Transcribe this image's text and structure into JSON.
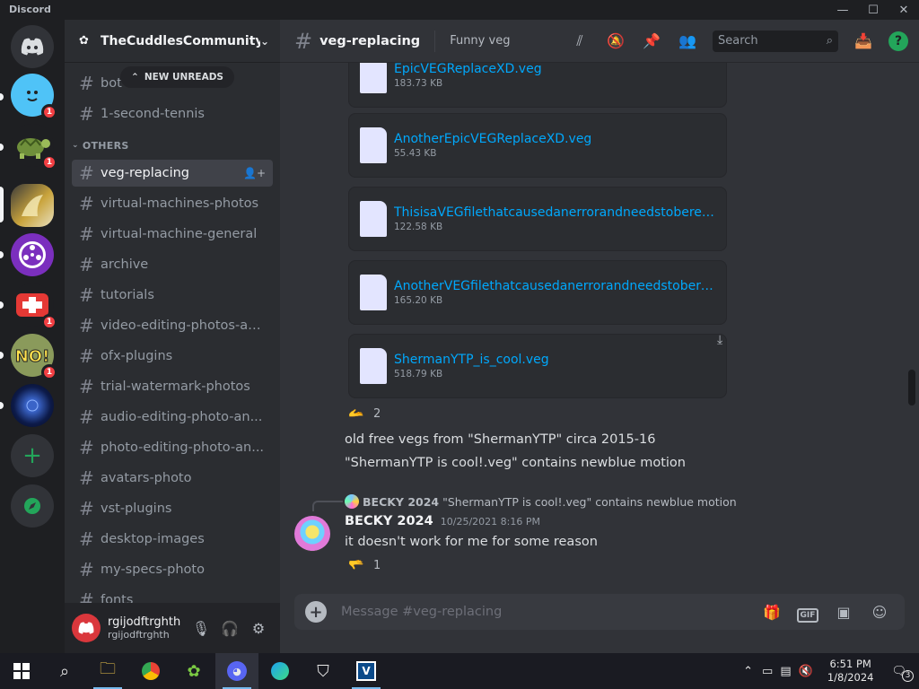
{
  "window": {
    "app_name": "Discord",
    "minimize": "—",
    "maximize": "☐",
    "close": "✕"
  },
  "servers": [
    {
      "name": "server-blue-face",
      "badge": "1",
      "color": "#4fc3f7"
    },
    {
      "name": "server-turtle",
      "badge": "1",
      "color": "#6f8f3b"
    },
    {
      "name": "server-yellow",
      "badge": "",
      "color": "#c9a43c"
    },
    {
      "name": "server-purple-reel",
      "badge": "",
      "color": "#7b2fbe"
    },
    {
      "name": "server-red-cross",
      "badge": "1",
      "color": "#e53935"
    },
    {
      "name": "server-no",
      "badge": "1",
      "color": "#8a9a5b"
    },
    {
      "name": "server-dark-nebula",
      "badge": "",
      "color": "#0d1b4a"
    }
  ],
  "guild": {
    "name": "TheCuddlesCommunity"
  },
  "new_unreads": "NEW UNREADS",
  "channels_top": [
    {
      "label": "bot"
    },
    {
      "label": "1-second-tennis"
    }
  ],
  "category_others": "OTHERS",
  "channels": [
    {
      "label": "veg-replacing",
      "active": true
    },
    {
      "label": "virtual-machines-photos"
    },
    {
      "label": "virtual-machine-general"
    },
    {
      "label": "archive"
    },
    {
      "label": "tutorials"
    },
    {
      "label": "video-editing-photos-an..."
    },
    {
      "label": "ofx-plugins"
    },
    {
      "label": "trial-watermark-photos"
    },
    {
      "label": "audio-editing-photo-an..."
    },
    {
      "label": "photo-editing-photo-an..."
    },
    {
      "label": "avatars-photo"
    },
    {
      "label": "vst-plugins"
    },
    {
      "label": "desktop-images"
    },
    {
      "label": "my-specs-photo"
    },
    {
      "label": "fonts"
    }
  ],
  "user": {
    "display": "rgijodftrghth",
    "username": "rgijodftrghth"
  },
  "channel_header": {
    "name": "veg-replacing",
    "topic": "Funny veg",
    "search_placeholder": "Search"
  },
  "files": [
    {
      "name": "EpicVEGReplaceXD.veg",
      "size": "183.73 KB"
    },
    {
      "name": "AnotherEpicVEGReplaceXD.veg",
      "size": "55.43 KB"
    },
    {
      "name": "ThisisaVEGfilethatcausedanerrorandneedstoberepl...",
      "size": "122.58 KB"
    },
    {
      "name": "AnotherVEGfilethatcausedanerrorandneedstobere...",
      "size": "165.20 KB"
    },
    {
      "name": "ShermanYTP_is_cool.veg",
      "size": "518.79 KB"
    }
  ],
  "reaction1": {
    "count": "2"
  },
  "messages": [
    "old free vegs from \"ShermanYTP\" circa 2015-16",
    "\"ShermanYTP is cool!.veg\" contains newblue motion"
  ],
  "reply": {
    "author": "BECKY 2024",
    "text": "\"ShermanYTP is cool!.veg\" contains newblue motion"
  },
  "post": {
    "author": "BECKY 2024",
    "timestamp": "10/25/2021 8:16 PM",
    "text": "it doesn't work for me for some reason"
  },
  "reaction2": {
    "count": "1"
  },
  "composer": {
    "placeholder": "Message #veg-replacing",
    "gif": "GIF"
  },
  "taskbar": {
    "time": "6:51 PM",
    "date": "1/8/2024",
    "notif": "3"
  }
}
